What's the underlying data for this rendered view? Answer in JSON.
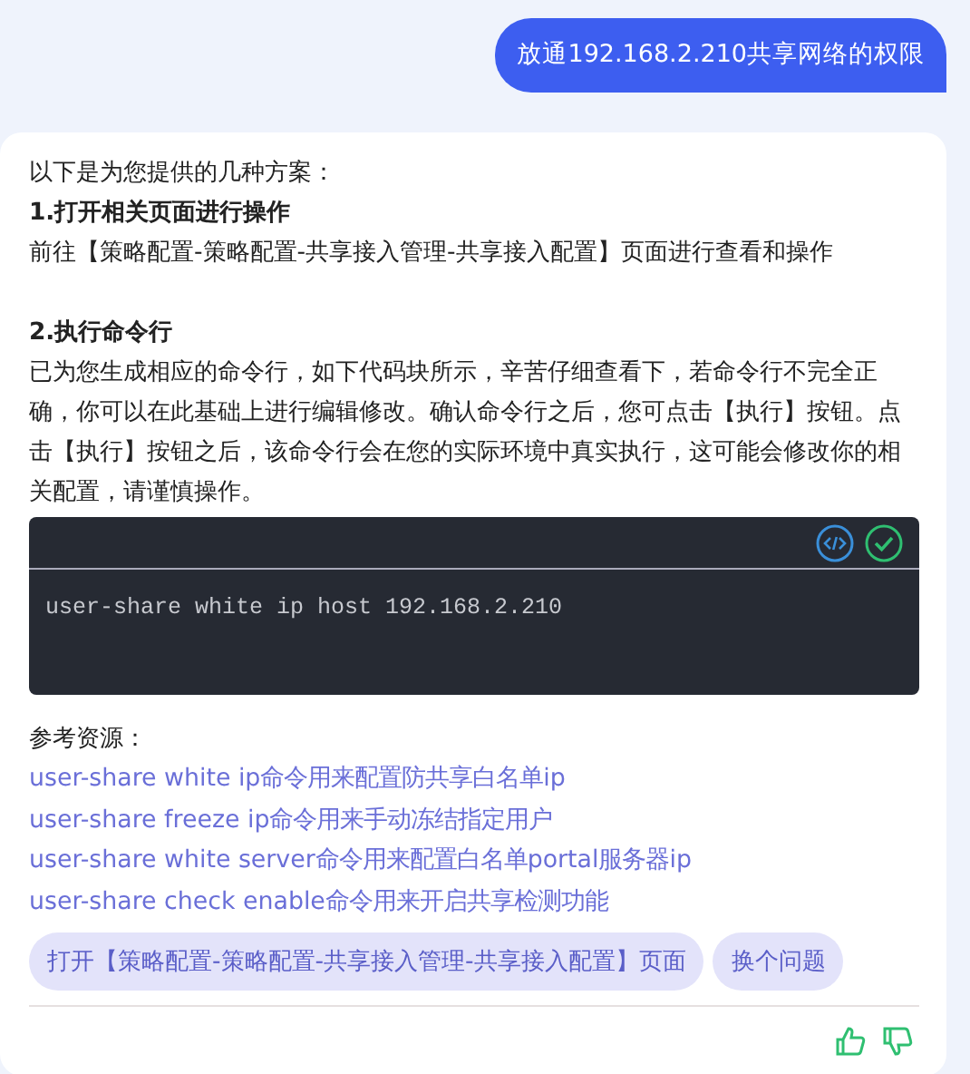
{
  "user_message": "放通192.168.2.210共享网络的权限",
  "answer": {
    "intro": "以下是为您提供的几种方案：",
    "sections": [
      {
        "heading": "1.打开相关页面进行操作",
        "body": "前往【策略配置-策略配置-共享接入管理-共享接入配置】页面进行查看和操作"
      },
      {
        "heading": "2.执行命令行",
        "body": "已为您生成相应的命令行，如下代码块所示，辛苦仔细查看下，若命令行不完全正确，你可以在此基础上进行编辑修改。确认命令行之后，您可点击【执行】按钮。点击【执行】按钮之后，该命令行会在您的实际环境中真实执行，这可能会修改你的相关配置，请谨慎操作。"
      }
    ],
    "code": "user-share white ip host 192.168.2.210",
    "references_label": "参考资源：",
    "references": [
      "user-share white ip命令用来配置防共享白名单ip",
      "user-share freeze ip命令用来手动冻结指定用户",
      "user-share white server命令用来配置白名单portal服务器ip",
      "user-share check enable命令用来开启共享检测功能"
    ],
    "suggestions": [
      "打开【策略配置-策略配置-共享接入管理-共享接入配置】页面",
      "换个问题"
    ]
  }
}
